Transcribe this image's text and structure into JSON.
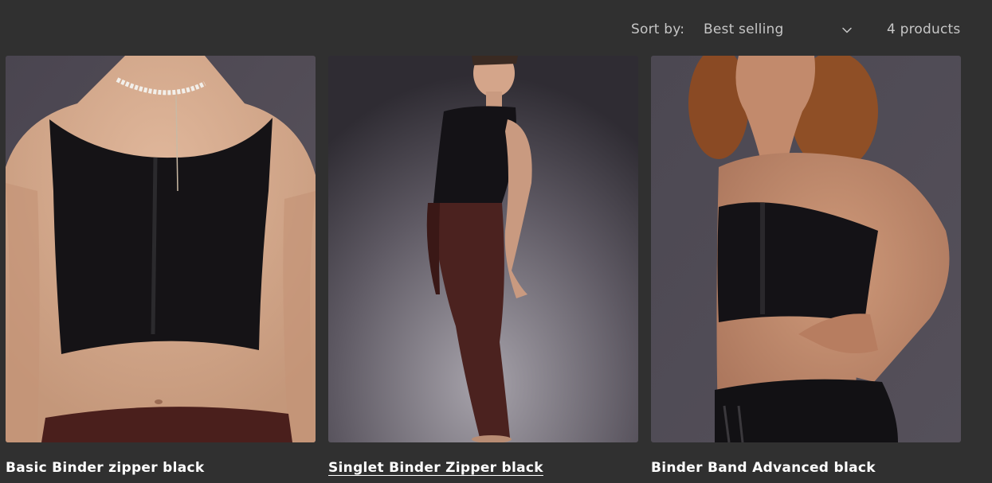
{
  "toolbar": {
    "sort_label": "Sort by:",
    "sort_selected": "Best selling",
    "product_count": "4 products"
  },
  "products": [
    {
      "title": "Basic Binder zipper black"
    },
    {
      "title": "Singlet Binder Zipper black"
    },
    {
      "title": "Binder Band Advanced black"
    }
  ],
  "colors": {
    "page_background": "#303030",
    "text_primary": "#ffffff",
    "text_secondary": "#c6c6c6"
  },
  "icons": {
    "sort_chevron": "chevron-down-icon"
  }
}
